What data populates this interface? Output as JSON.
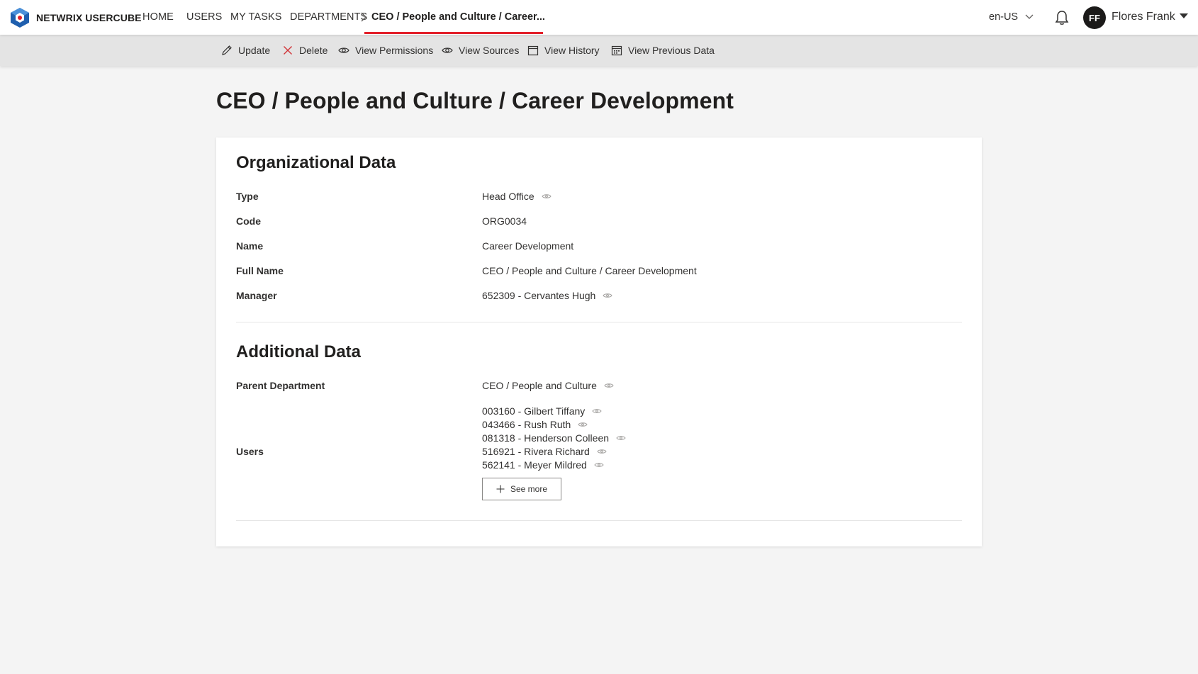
{
  "header": {
    "brand": "NETWRIX USERCUBE",
    "nav": [
      "HOME",
      "USERS",
      "MY TASKS",
      "DEPARTMENTS"
    ],
    "breadcrumb_active": "CEO / People and Culture / Career...",
    "language": "en-US",
    "user_initials": "FF",
    "user_name": "Flores Frank",
    "accent_color": "#e3202b"
  },
  "toolbar": {
    "update": "Update",
    "delete": "Delete",
    "view_permissions": "View Permissions",
    "view_sources": "View Sources",
    "view_history": "View History",
    "view_previous_data": "View Previous Data"
  },
  "page": {
    "title": "CEO / People and Culture / Career Development"
  },
  "organizational": {
    "title": "Organizational Data",
    "fields": [
      {
        "label": "Type",
        "value": "Head Office"
      },
      {
        "label": "Code",
        "value": "ORG0034"
      },
      {
        "label": "Name",
        "value": "Career Development"
      },
      {
        "label": "Full Name",
        "value": "CEO / People and Culture / Career Development"
      },
      {
        "label": "Manager",
        "value": "652309 - Cervantes Hugh"
      }
    ]
  },
  "additional": {
    "title": "Additional Data",
    "parent_label": "Parent Department",
    "parent_value": "CEO / People and Culture",
    "users_label": "Users",
    "users": [
      "003160 - Gilbert Tiffany",
      "043466 - Rush Ruth",
      "081318 - Henderson Colleen",
      "516921 - Rivera Richard",
      "562141 - Meyer Mildred"
    ],
    "see_more": "See more"
  }
}
